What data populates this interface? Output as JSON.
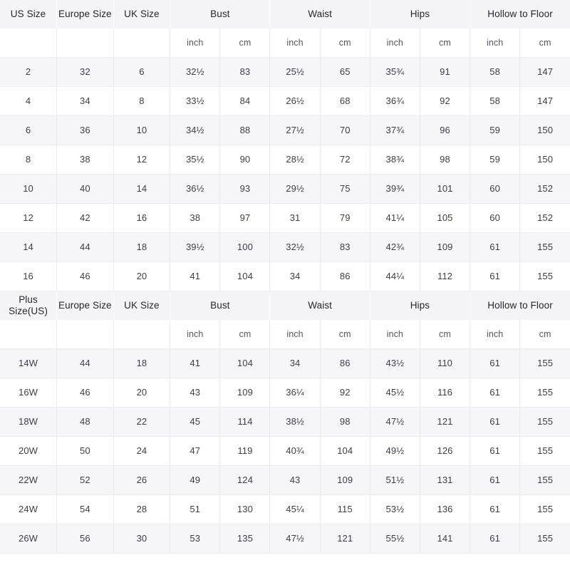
{
  "tables": [
    {
      "name": "standard-size-table",
      "group_headers": [
        {
          "label": "US Size",
          "span": 1
        },
        {
          "label": "Europe Size",
          "span": 1
        },
        {
          "label": "UK Size",
          "span": 1
        },
        {
          "label": "Bust",
          "span": 2
        },
        {
          "label": "Waist",
          "span": 2
        },
        {
          "label": "Hips",
          "span": 2
        },
        {
          "label": "Hollow to Floor",
          "span": 2
        }
      ],
      "unit_row": [
        "",
        "",
        "",
        "inch",
        "cm",
        "inch",
        "cm",
        "inch",
        "cm",
        "inch",
        "cm"
      ],
      "rows": [
        [
          "2",
          "32",
          "6",
          "32½",
          "83",
          "25½",
          "65",
          "35¾",
          "91",
          "58",
          "147"
        ],
        [
          "4",
          "34",
          "8",
          "33½",
          "84",
          "26½",
          "68",
          "36¾",
          "92",
          "58",
          "147"
        ],
        [
          "6",
          "36",
          "10",
          "34½",
          "88",
          "27½",
          "70",
          "37¾",
          "96",
          "59",
          "150"
        ],
        [
          "8",
          "38",
          "12",
          "35½",
          "90",
          "28½",
          "72",
          "38¾",
          "98",
          "59",
          "150"
        ],
        [
          "10",
          "40",
          "14",
          "36½",
          "93",
          "29½",
          "75",
          "39¾",
          "101",
          "60",
          "152"
        ],
        [
          "12",
          "42",
          "16",
          "38",
          "97",
          "31",
          "79",
          "41¼",
          "105",
          "60",
          "152"
        ],
        [
          "14",
          "44",
          "18",
          "39½",
          "100",
          "32½",
          "83",
          "42¾",
          "109",
          "61",
          "155"
        ],
        [
          "16",
          "46",
          "20",
          "41",
          "104",
          "34",
          "86",
          "44¼",
          "112",
          "61",
          "155"
        ]
      ]
    },
    {
      "name": "plus-size-table",
      "group_headers": [
        {
          "label": "Plus Size(US)",
          "span": 1
        },
        {
          "label": "Europe Size",
          "span": 1
        },
        {
          "label": "UK Size",
          "span": 1
        },
        {
          "label": "Bust",
          "span": 2
        },
        {
          "label": "Waist",
          "span": 2
        },
        {
          "label": "Hips",
          "span": 2
        },
        {
          "label": "Hollow to Floor",
          "span": 2
        }
      ],
      "unit_row": [
        "",
        "",
        "",
        "inch",
        "cm",
        "inch",
        "cm",
        "inch",
        "cm",
        "inch",
        "cm"
      ],
      "rows": [
        [
          "14W",
          "44",
          "18",
          "41",
          "104",
          "34",
          "86",
          "43½",
          "110",
          "61",
          "155"
        ],
        [
          "16W",
          "46",
          "20",
          "43",
          "109",
          "36¼",
          "92",
          "45½",
          "116",
          "61",
          "155"
        ],
        [
          "18W",
          "48",
          "22",
          "45",
          "114",
          "38½",
          "98",
          "47½",
          "121",
          "61",
          "155"
        ],
        [
          "20W",
          "50",
          "24",
          "47",
          "119",
          "40¾",
          "104",
          "49½",
          "126",
          "61",
          "155"
        ],
        [
          "22W",
          "52",
          "26",
          "49",
          "124",
          "43",
          "109",
          "51½",
          "131",
          "61",
          "155"
        ],
        [
          "24W",
          "54",
          "28",
          "51",
          "130",
          "45¼",
          "115",
          "53½",
          "136",
          "61",
          "155"
        ],
        [
          "26W",
          "56",
          "30",
          "53",
          "135",
          "47½",
          "121",
          "55½",
          "141",
          "61",
          "155"
        ]
      ]
    }
  ],
  "colors": {
    "header_bg": "#f4f4f7",
    "row_odd_bg": "#f6f6f9",
    "row_even_bg": "#ffffff",
    "border": "#e8e8ed",
    "text": "#3d3d46"
  }
}
